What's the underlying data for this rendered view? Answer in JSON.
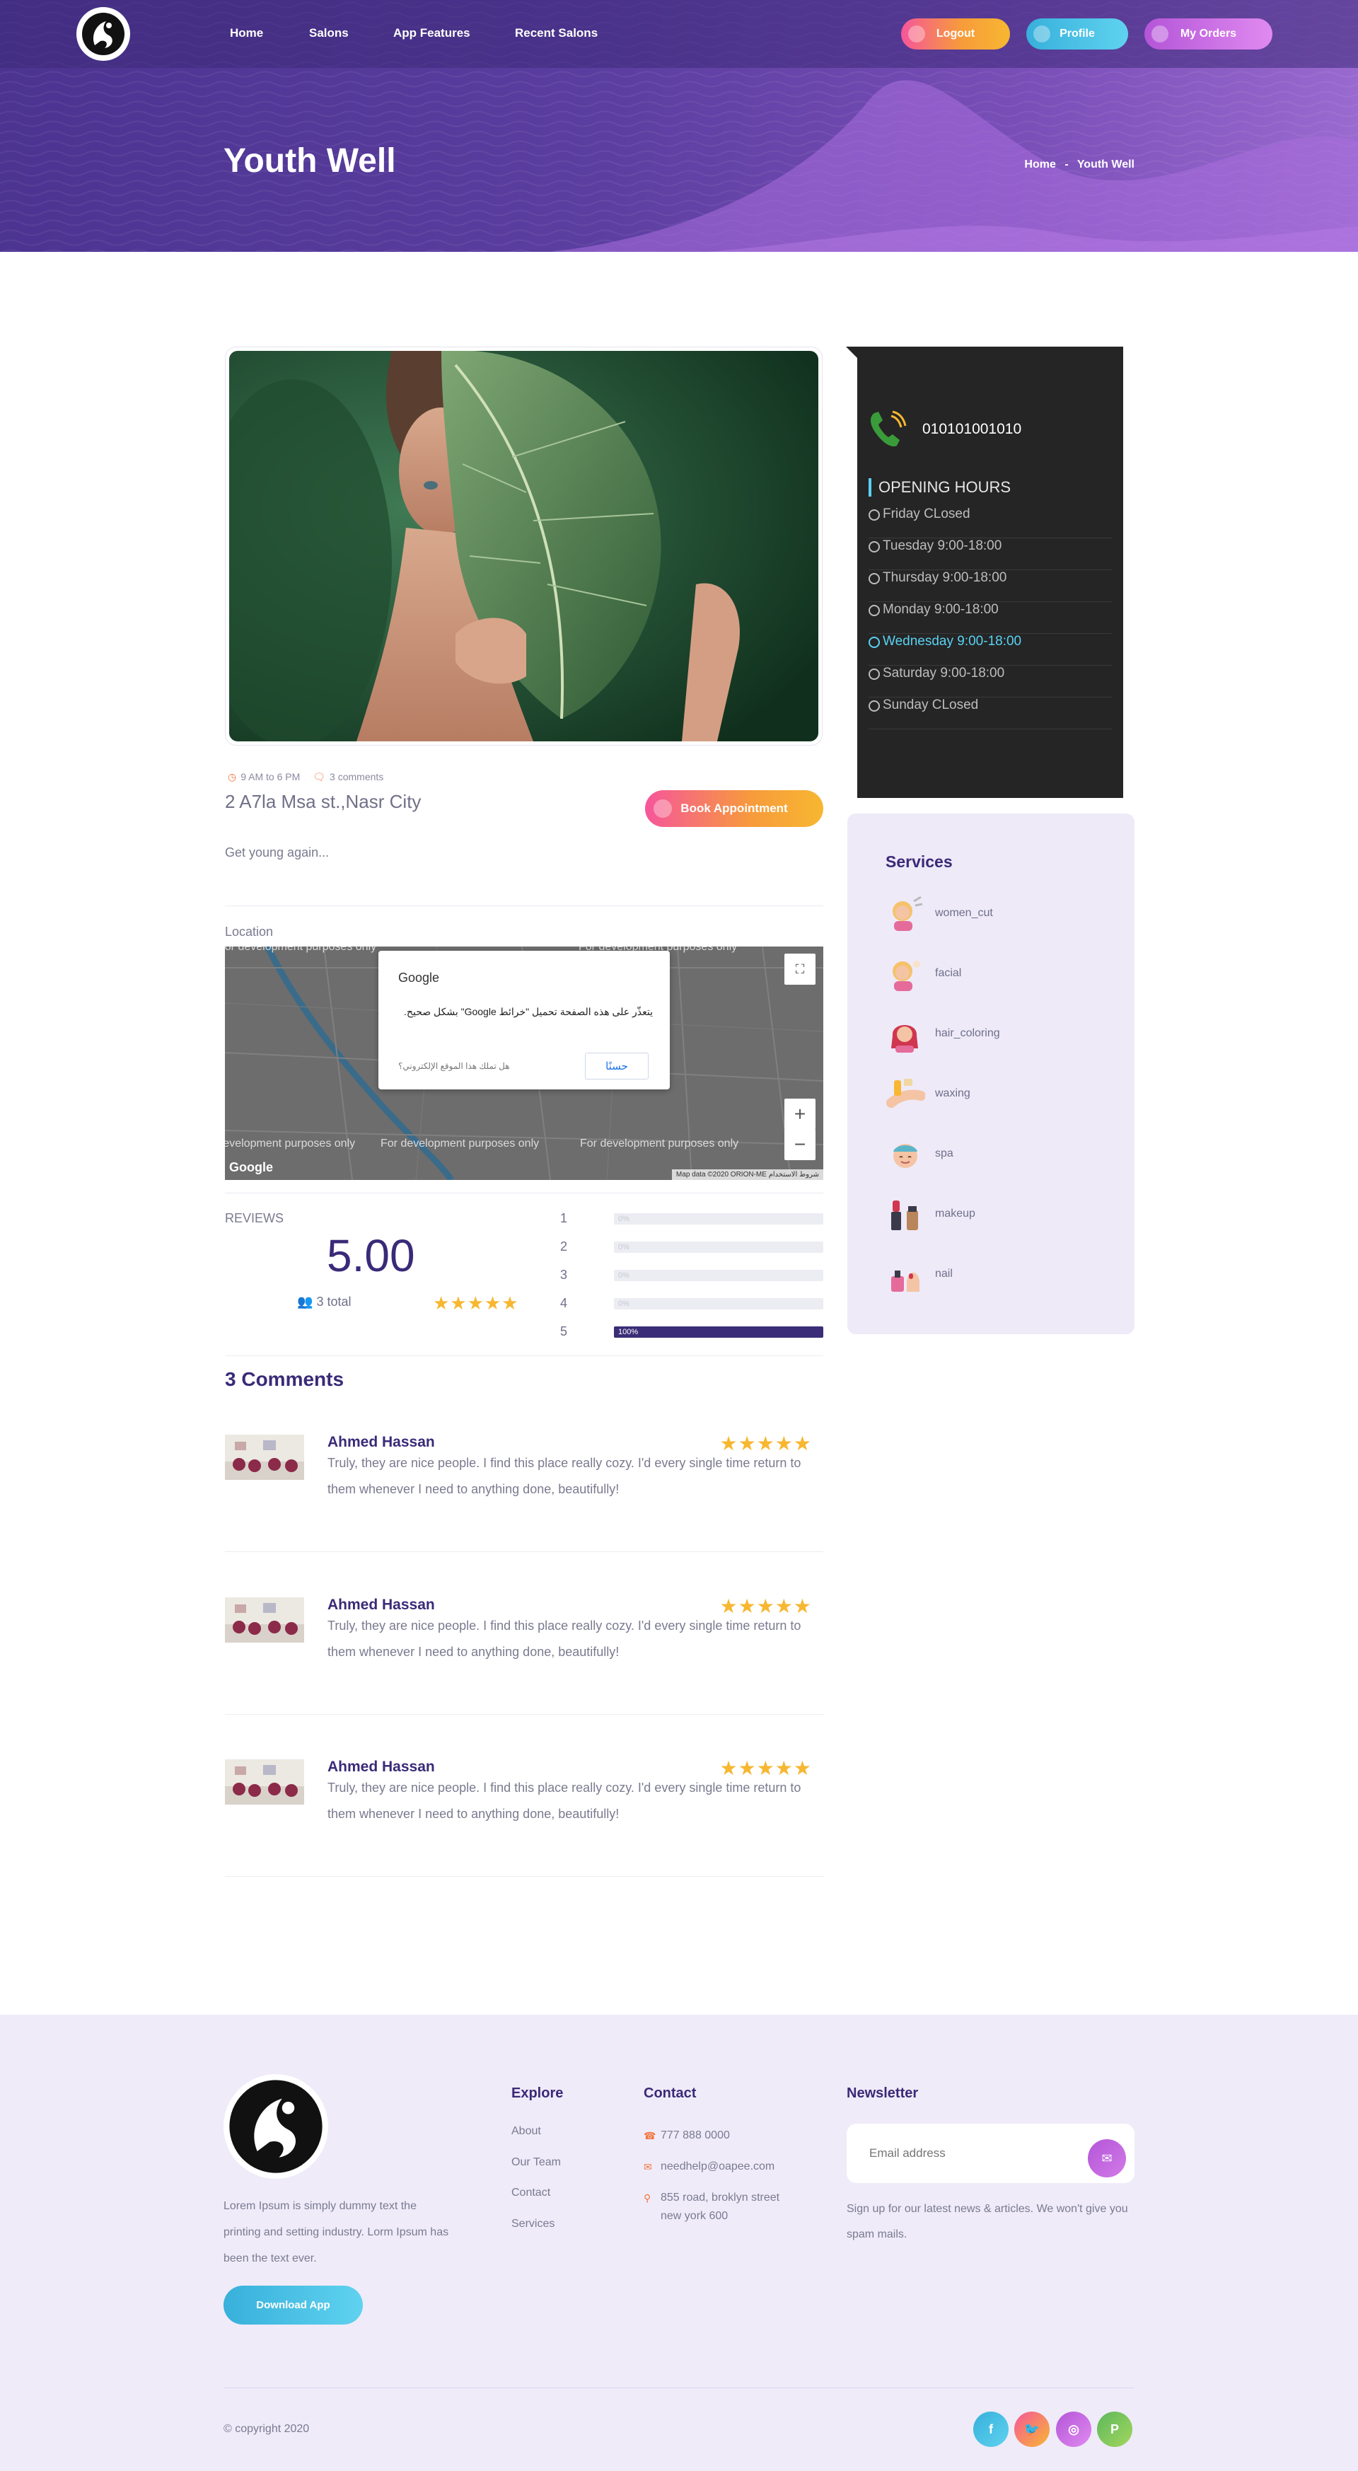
{
  "nav": {
    "links": [
      "Home",
      "Salons",
      "App Features",
      "Recent Salons"
    ],
    "logout": "Logout",
    "profile": "Profile",
    "orders": "My Orders"
  },
  "hero": {
    "title": "Youth Well",
    "crumb_home": "Home",
    "crumb_sep": "-",
    "crumb_current": "Youth Well"
  },
  "salon": {
    "hours_meta": "9 AM to 6 PM",
    "comments_meta": "3 comments",
    "address": "2 A7la Msa st.,Nasr City",
    "book_label": "Book Appointment",
    "description": "Get young again..."
  },
  "location": {
    "label": "Location",
    "watermark": "For development purposes only",
    "dialog_title": "Google",
    "dialog_body": "يتعذّر على هذه الصفحة تحميل \"خرائط Google\" بشكل صحيح.",
    "dialog_question": "هل تملك هذا الموقع الإلكتروني؟",
    "dialog_ok": "حسنًا",
    "google_logo": "Google",
    "map_footer": "Map data ©2020 ORION-ME   شروط الاستخدام"
  },
  "reviews": {
    "label": "REVIEWS",
    "score": "5.00",
    "total": "3 total",
    "breakdown": [
      {
        "stars": "1",
        "percent": 0,
        "label": "0%"
      },
      {
        "stars": "2",
        "percent": 0,
        "label": "0%"
      },
      {
        "stars": "3",
        "percent": 0,
        "label": "0%"
      },
      {
        "stars": "4",
        "percent": 0,
        "label": "0%"
      },
      {
        "stars": "5",
        "percent": 100,
        "label": "100%"
      }
    ],
    "rating_stars": 5
  },
  "comments": {
    "title": "3 Comments",
    "items": [
      {
        "name": "Ahmed Hassan",
        "text": "Truly, they are nice people. I find this place really cozy. I'd every single time return to them whenever I need to anything done, beautifully!",
        "stars": 5
      },
      {
        "name": "Ahmed Hassan",
        "text": "Truly, they are nice people. I find this place really cozy. I'd every single time return to them whenever I need to anything done, beautifully!",
        "stars": 5
      },
      {
        "name": "Ahmed Hassan",
        "text": "Truly, they are nice people. I find this place really cozy. I'd every single time return to them whenever I need to anything done, beautifully!",
        "stars": 5
      }
    ]
  },
  "sidebar": {
    "phone": "010101001010",
    "hours_title": "OPENING HOURS",
    "hours": [
      {
        "text": "Friday CLosed",
        "today": false
      },
      {
        "text": "Tuesday 9:00-18:00",
        "today": false
      },
      {
        "text": "Thursday 9:00-18:00",
        "today": false
      },
      {
        "text": "Monday 9:00-18:00",
        "today": false
      },
      {
        "text": "Wednesday 9:00-18:00",
        "today": true
      },
      {
        "text": "Saturday 9:00-18:00",
        "today": false
      },
      {
        "text": "Sunday CLosed",
        "today": false
      }
    ],
    "services_title": "Services",
    "services": [
      "women_cut",
      "facial",
      "hair_coloring",
      "waxing",
      "spa",
      "makeup",
      "nail"
    ]
  },
  "footer": {
    "about": "Lorem Ipsum is simply dummy text the printing and setting industry. Lorm Ipsum has been the text ever.",
    "download": "Download App",
    "explore_title": "Explore",
    "explore_links": [
      "About",
      "Our Team",
      "Contact",
      "Services"
    ],
    "contact_title": "Contact",
    "phone": "777 888 0000",
    "email": "needhelp@oapee.com",
    "address": "855 road, broklyn street new york 600",
    "newsletter_title": "Newsletter",
    "newsletter_placeholder": "Email address",
    "newsletter_note": "Sign up for our latest news & articles. We won't give you spam mails.",
    "copyright": "© copyright 2020",
    "social_icons": [
      "facebook-icon",
      "twitter-icon",
      "instagram-icon",
      "pinterest-icon"
    ]
  },
  "colors": {
    "brand_purple": "#3a2a78",
    "accent_orange": "#f79b3b",
    "accent_cyan": "#59d2f2",
    "star_yellow": "#f7b731"
  }
}
